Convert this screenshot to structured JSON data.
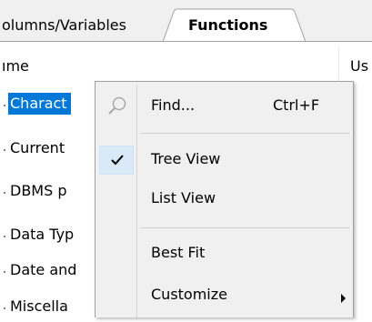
{
  "tabs": [
    {
      "label": "olumns/Variables",
      "active": false
    },
    {
      "label": "Functions",
      "active": true
    }
  ],
  "list": {
    "columns": [
      "ıme",
      "Us"
    ],
    "rows": [
      {
        "label": "Charact",
        "selected": true
      },
      {
        "label": "Current",
        "selected": false
      },
      {
        "label": "DBMS p",
        "selected": false
      },
      {
        "label": "Data Typ",
        "selected": false
      },
      {
        "label": "Date and",
        "selected": false
      },
      {
        "label": "Miscella",
        "selected": false
      }
    ]
  },
  "context_menu": {
    "find": {
      "label": "Find...",
      "shortcut": "Ctrl+F",
      "icon": "magnifier-icon"
    },
    "tree_view": {
      "label": "Tree View",
      "checked": true,
      "icon": "checkmark-icon"
    },
    "list_view": {
      "label": "List View",
      "checked": false
    },
    "best_fit": {
      "label": "Best Fit"
    },
    "customize": {
      "label": "Customize",
      "submenu": true,
      "icon": "submenu-arrow-icon"
    }
  },
  "colors": {
    "selection": "#0078d7",
    "menu_background": "#f0f0f0",
    "checked_highlight": "#d9e9f8"
  }
}
